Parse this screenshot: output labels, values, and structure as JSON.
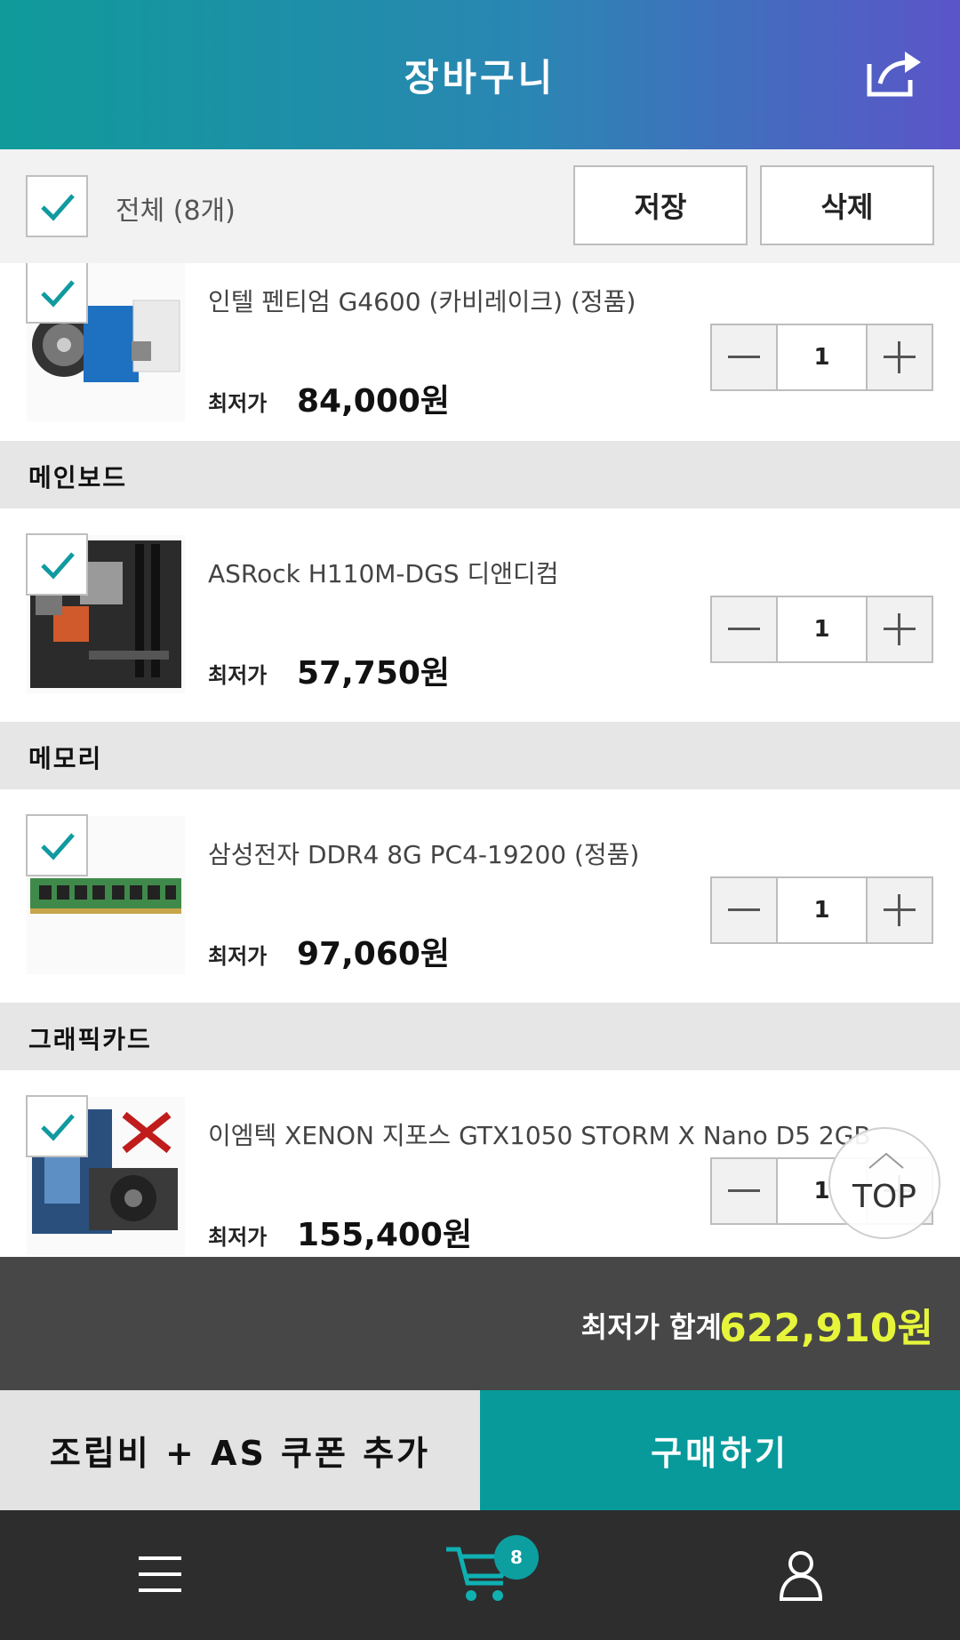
{
  "header": {
    "title": "장바구니",
    "share_icon": "share-icon"
  },
  "toolbar": {
    "select_all_label": "전체 (8개)",
    "save_label": "저장",
    "delete_label": "삭제"
  },
  "items": [
    {
      "category": "",
      "name": "인텔 펜티엄 G4600 (카비레이크) (정품)",
      "price_label": "최저가",
      "price": "84,000원",
      "quantity": "1",
      "checked": true
    },
    {
      "category": "메인보드",
      "name": "ASRock H110M-DGS 디앤디컴",
      "price_label": "최저가",
      "price": "57,750원",
      "quantity": "1",
      "checked": true
    },
    {
      "category": "메모리",
      "name": "삼성전자 DDR4 8G PC4-19200 (정품)",
      "price_label": "최저가",
      "price": "97,060원",
      "quantity": "1",
      "checked": true
    },
    {
      "category": "그래픽카드",
      "name": "이엠텍 XENON 지포스 GTX1050 STORM X Nano D5 2GB",
      "price_label": "최저가",
      "price": "155,400원",
      "quantity": "1",
      "checked": true
    }
  ],
  "top_button": {
    "label": "TOP"
  },
  "total": {
    "label": "최저가 합계",
    "value": "622,910원"
  },
  "actions": {
    "coupon_label": "조립비 + AS 쿠폰 추가",
    "buy_label": "구매하기"
  },
  "bottom_nav": {
    "cart_badge": "8"
  },
  "colors": {
    "accent": "#089a9b",
    "total_highlight": "#e6f53a",
    "header_gradient_end": "#5b55c9"
  }
}
